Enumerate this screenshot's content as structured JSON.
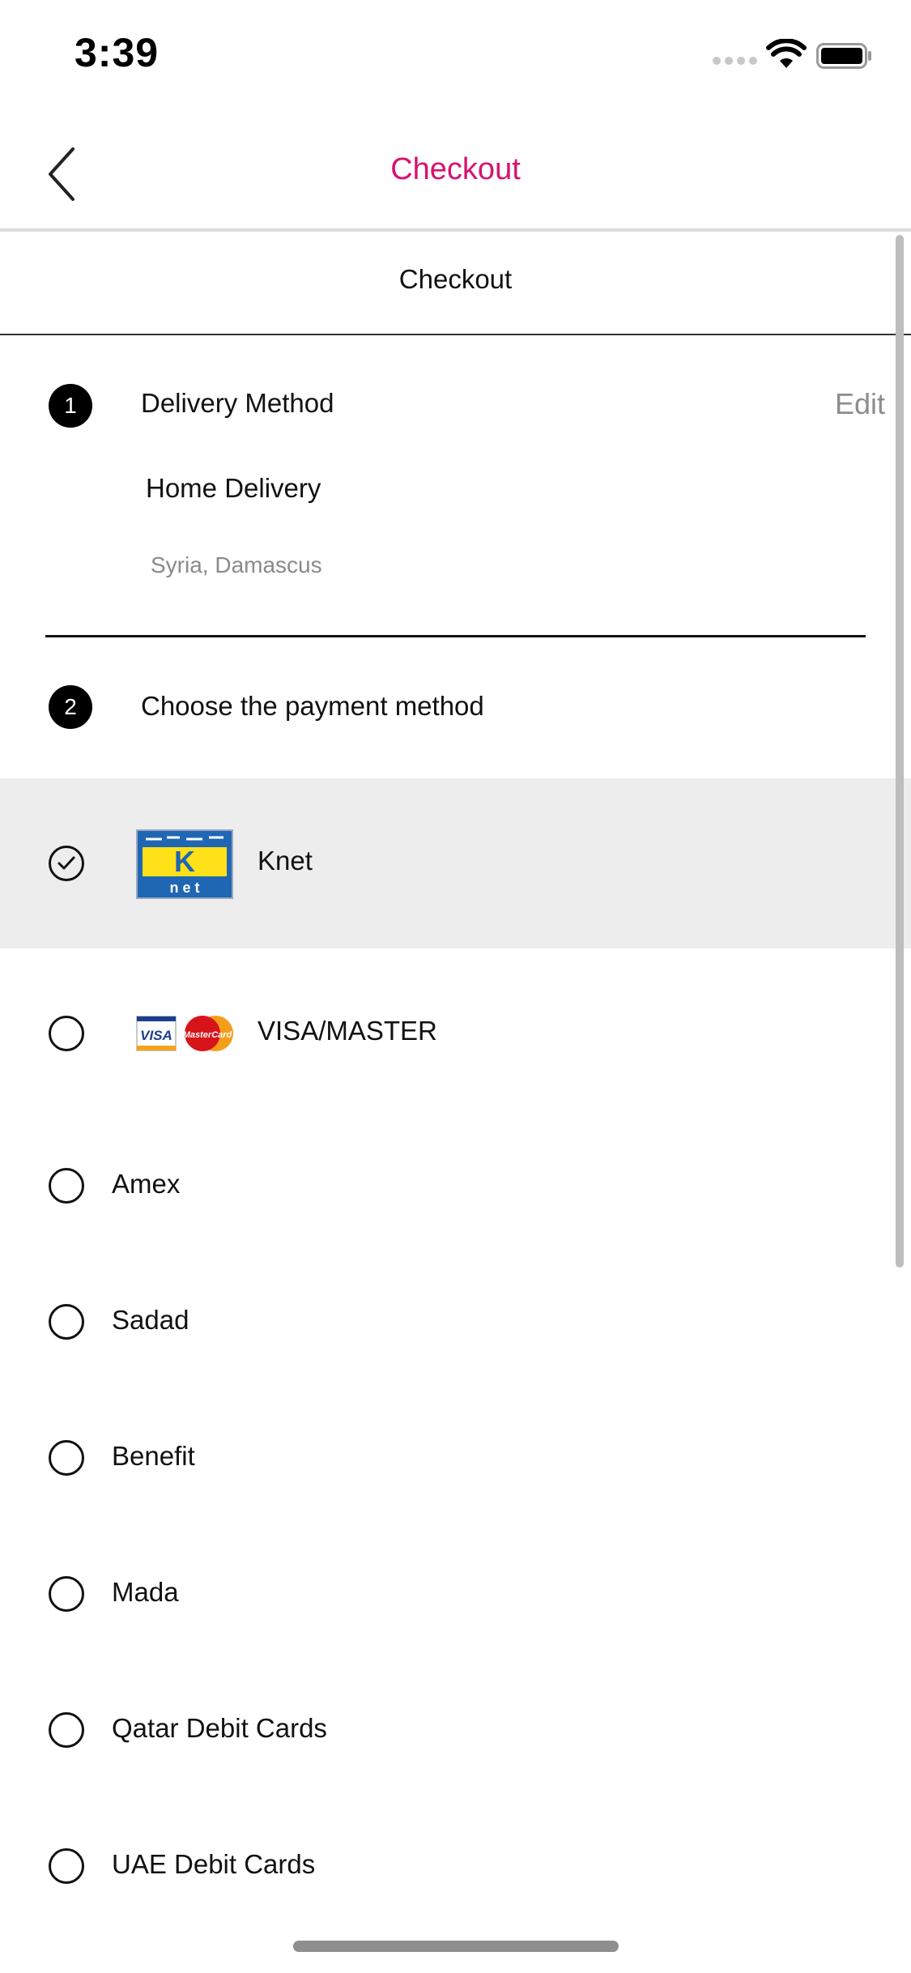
{
  "status_bar": {
    "time": "3:39"
  },
  "nav": {
    "title": "Checkout",
    "accent_color": "#d7126f",
    "back_icon": "chevron-left-icon"
  },
  "section": {
    "title": "Checkout"
  },
  "step1": {
    "number": "1",
    "label": "Delivery Method",
    "edit_label": "Edit",
    "delivery_type": "Home Delivery",
    "address": "Syria, Damascus"
  },
  "step2": {
    "number": "2",
    "label": "Choose the payment method"
  },
  "payment_methods": [
    {
      "label": "Knet",
      "selected": true,
      "icon": "knet-logo"
    },
    {
      "label": "VISA/MASTER",
      "selected": false,
      "icon": "visa-mastercard-logo"
    },
    {
      "label": "Amex",
      "selected": false
    },
    {
      "label": "Sadad",
      "selected": false
    },
    {
      "label": "Benefit",
      "selected": false
    },
    {
      "label": "Mada",
      "selected": false
    },
    {
      "label": "Qatar Debit Cards",
      "selected": false
    },
    {
      "label": "UAE Debit Cards",
      "selected": false
    }
  ],
  "logos": {
    "knet_letter": "K",
    "knet_word": "n e t",
    "visa_text": "VISA",
    "master_text": "MasterCard"
  }
}
